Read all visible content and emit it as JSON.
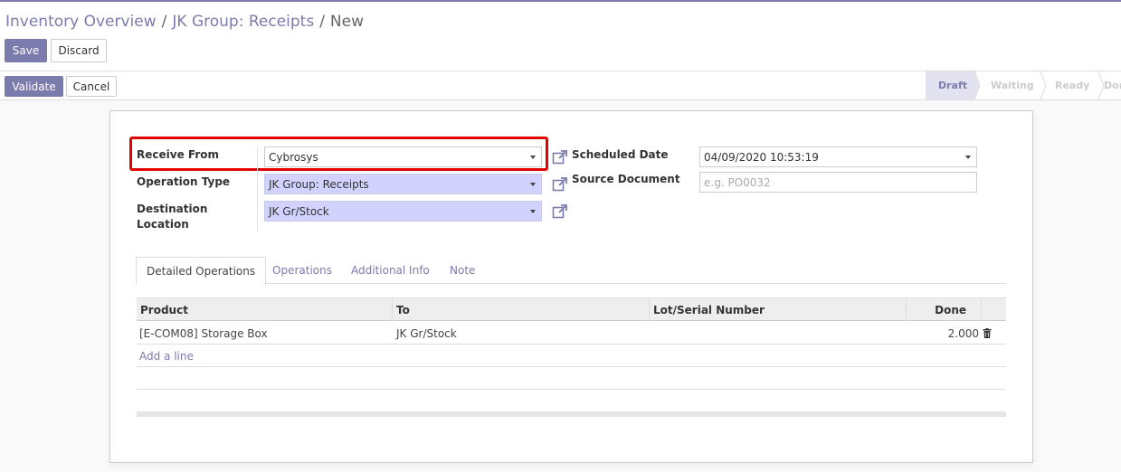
{
  "breadcrumb": {
    "items": [
      "Inventory Overview",
      "JK Group: Receipts"
    ],
    "current": "New"
  },
  "actions": {
    "save_label": "Save",
    "discard_label": "Discard",
    "validate_label": "Validate",
    "cancel_label": "Cancel"
  },
  "statusbar": {
    "stages": [
      "Draft",
      "Waiting",
      "Ready",
      "Done"
    ],
    "current": "Draft"
  },
  "form": {
    "receive_from": {
      "label": "Receive From",
      "value": "Cybrosys"
    },
    "operation_type": {
      "label": "Operation Type",
      "value": "JK Group: Receipts"
    },
    "destination_location": {
      "label_line1": "Destination",
      "label_line2": "Location",
      "value": "JK Gr/Stock"
    },
    "scheduled_date": {
      "label": "Scheduled Date",
      "value": "04/09/2020 10:53:19"
    },
    "source_document": {
      "label": "Source Document",
      "placeholder": "e.g. PO0032"
    }
  },
  "tabs": [
    "Detailed Operations",
    "Operations",
    "Additional Info",
    "Note"
  ],
  "table": {
    "columns": [
      "Product",
      "To",
      "Lot/Serial Number",
      "Done"
    ],
    "rows": [
      {
        "product": "[E-COM08] Storage Box",
        "to": "JK Gr/Stock",
        "lot": "",
        "done": "2.000"
      }
    ],
    "add_line": "Add a line"
  },
  "colors": {
    "brand": "#7c7bad",
    "required_field": "#d2d2ff",
    "highlight": "#e30000"
  },
  "icons": {
    "external_link": "external-link-icon",
    "delete": "trash-icon",
    "dropdown": "caret-down-icon"
  }
}
